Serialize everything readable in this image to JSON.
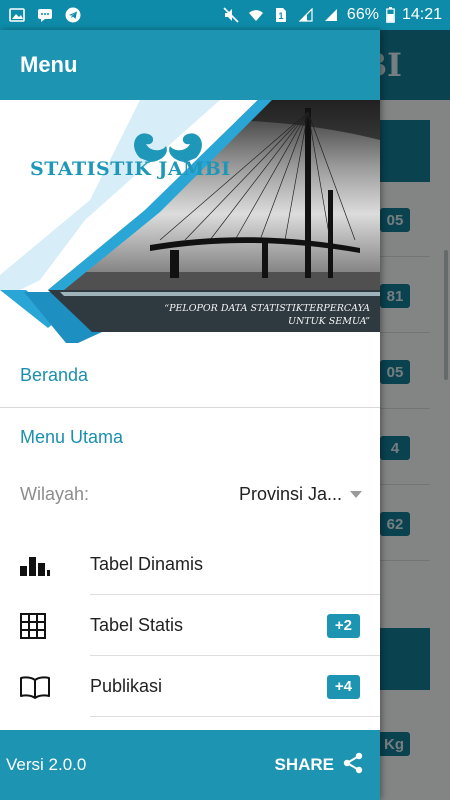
{
  "status_bar": {
    "battery": "66%",
    "time": "14:21",
    "icons_left": [
      "image-icon",
      "message-icon",
      "telegram-icon"
    ],
    "icons_right": [
      "mute-icon",
      "wifi-icon",
      "sim-1-icon",
      "signal-icon",
      "signal-icon",
      "battery-icon"
    ]
  },
  "background": {
    "title": "BI",
    "badges": [
      "05",
      "81",
      "05",
      "4",
      "62",
      "Kg"
    ]
  },
  "drawer": {
    "title": "Menu",
    "banner": {
      "logo_text": "STATISTIK JAMBI",
      "tagline_line1": "“PELOPOR DATA STATISTIKTERPERCAYA",
      "tagline_line2": "UNTUK SEMUA”"
    },
    "home_label": "Beranda",
    "main_menu_label": "Menu Utama",
    "region": {
      "label": "Wilayah:",
      "value": "Provinsi Ja..."
    },
    "items": [
      {
        "label": "Tabel Dinamis",
        "icon": "bar-chart-icon",
        "count": ""
      },
      {
        "label": "Tabel Statis",
        "icon": "grid-table-icon",
        "count": "+2"
      },
      {
        "label": "Publikasi",
        "icon": "book-icon",
        "count": "+4"
      }
    ],
    "footer": {
      "version": "Versi 2.0.0",
      "share_label": "SHARE"
    }
  },
  "colors": {
    "primary": "#1c94b2",
    "primary_dark": "#0e8ba8",
    "accent_text": "#1c8fb0"
  }
}
